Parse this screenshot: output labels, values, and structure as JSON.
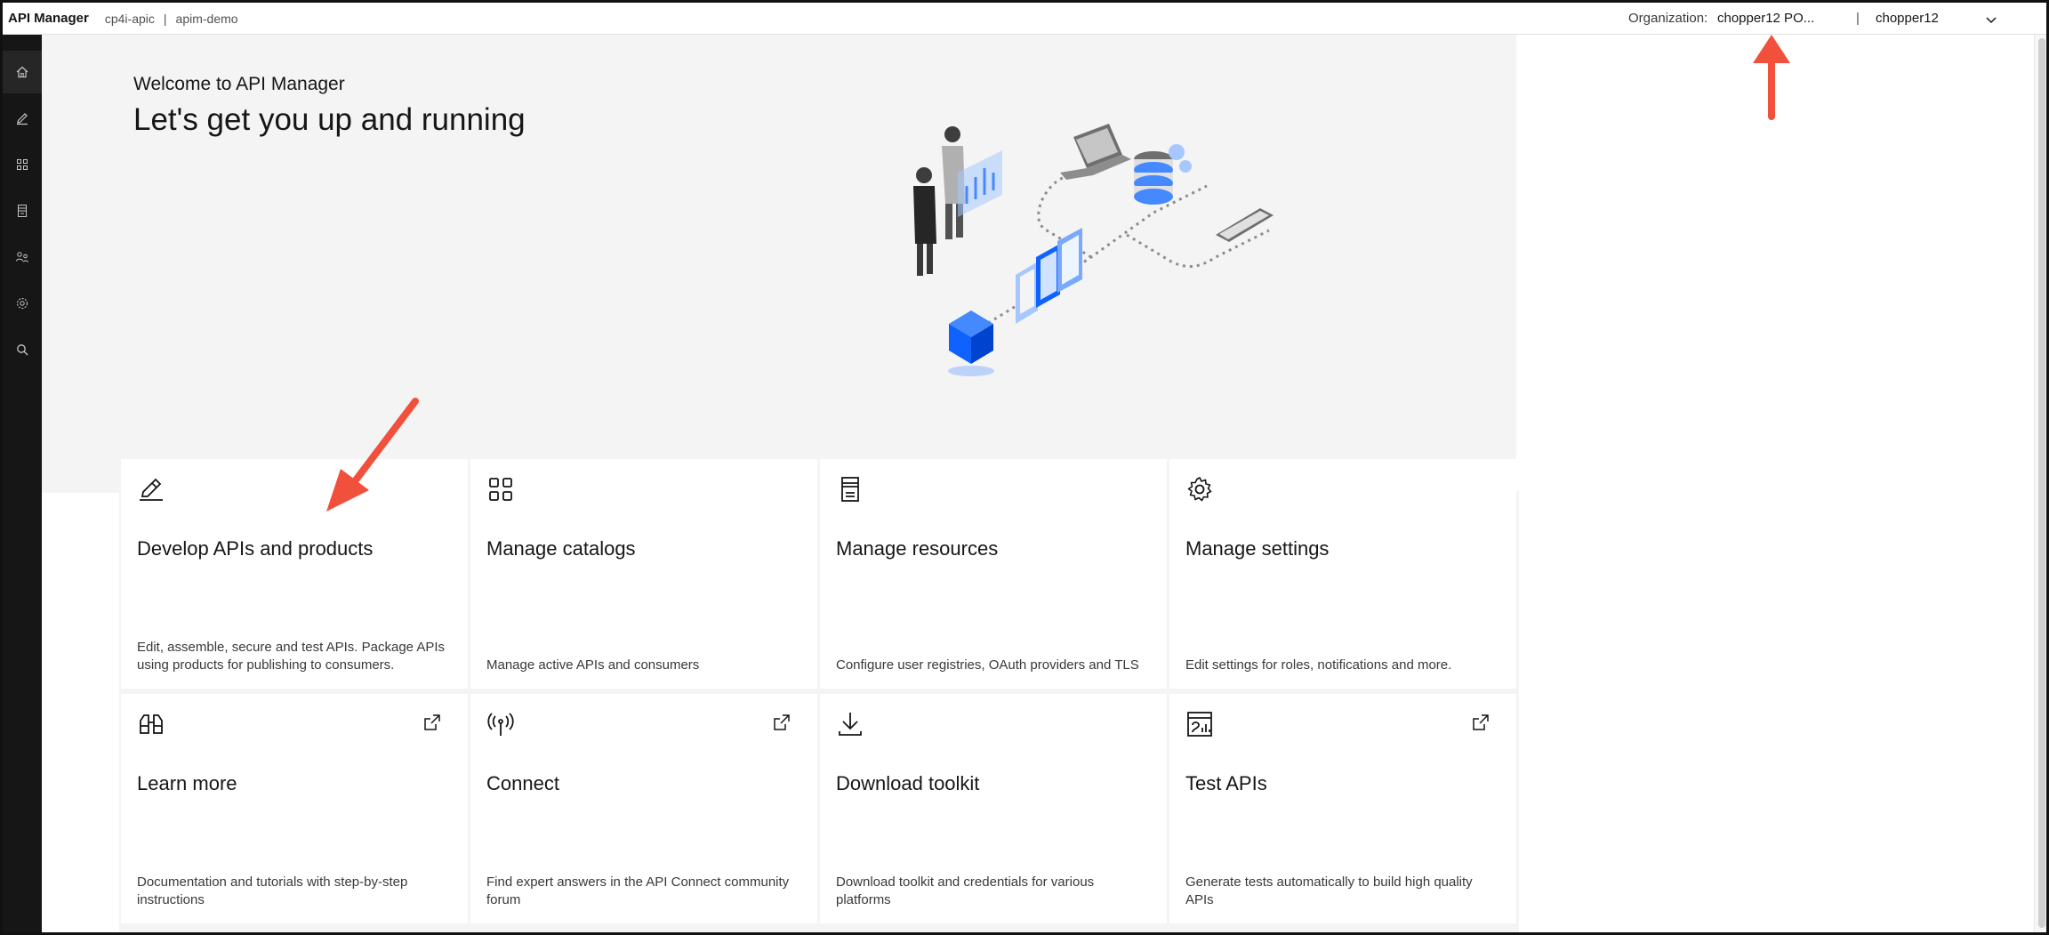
{
  "header": {
    "brand": "API Manager",
    "crumb_1": "cp4i-apic",
    "crumb_sep": "|",
    "crumb_2": "apim-demo",
    "org_label": "Organization:",
    "org_value": "chopper12 PO...",
    "separator": "|",
    "user_name": "chopper12"
  },
  "sidebar": {
    "items": [
      {
        "icon": "home-icon",
        "active": true
      },
      {
        "icon": "edit-icon"
      },
      {
        "icon": "catalog-icon"
      },
      {
        "icon": "resources-icon"
      },
      {
        "icon": "members-icon"
      },
      {
        "icon": "settings-icon"
      },
      {
        "icon": "search-icon"
      }
    ]
  },
  "hero": {
    "subtitle": "Welcome to API Manager",
    "title": "Let's get you up and running"
  },
  "tiles": [
    {
      "icon": "pencil-icon",
      "title": "Develop APIs and products",
      "desc": "Edit, assemble, secure and test APIs. Package APIs using products for publishing to consumers.",
      "external": false
    },
    {
      "icon": "grid-icon",
      "title": "Manage catalogs",
      "desc": "Manage active APIs and consumers",
      "external": false
    },
    {
      "icon": "document-icon",
      "title": "Manage resources",
      "desc": "Configure user registries, OAuth providers and TLS",
      "external": false
    },
    {
      "icon": "gear-icon",
      "title": "Manage settings",
      "desc": "Edit settings for roles, notifications and more.",
      "external": false
    },
    {
      "icon": "binoculars-icon",
      "title": "Learn more",
      "desc": "Documentation and tutorials with step-by-step instructions",
      "external": true
    },
    {
      "icon": "antenna-icon",
      "title": "Connect",
      "desc": "Find expert answers in the API Connect community forum",
      "external": true
    },
    {
      "icon": "download-icon",
      "title": "Download toolkit",
      "desc": "Download toolkit and credentials for various platforms",
      "external": false
    },
    {
      "icon": "test-chart-icon",
      "title": "Test APIs",
      "desc": "Generate tests automatically to build high quality APIs",
      "external": true
    }
  ],
  "colors": {
    "sidebar_bg": "#161616",
    "hero_bg": "#f4f4f4",
    "accent_blue": "#0f62fe",
    "annotation_red": "#f0503c"
  }
}
